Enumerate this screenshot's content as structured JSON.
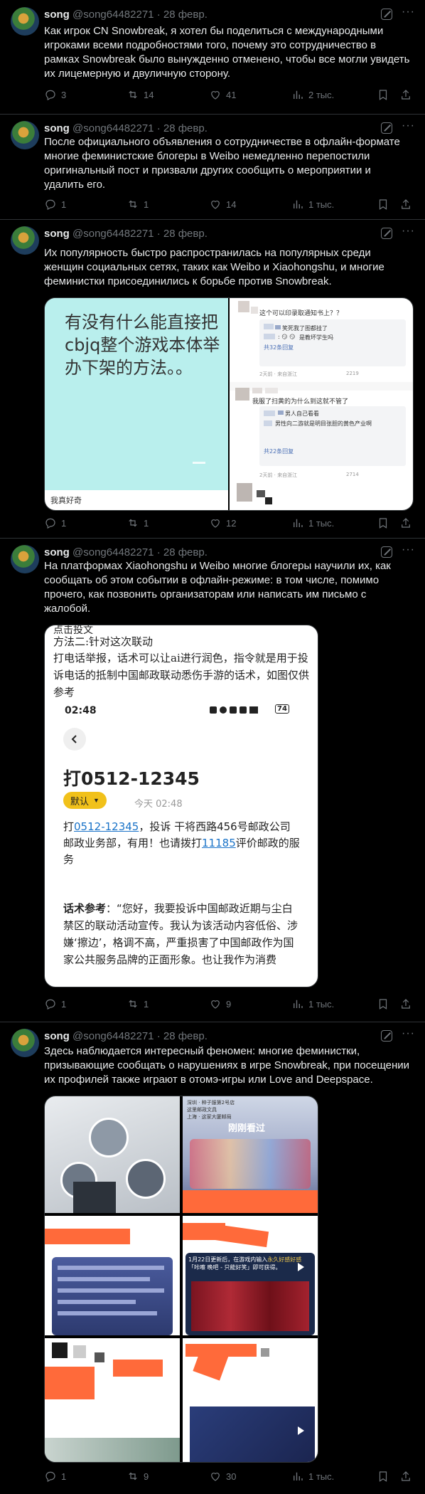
{
  "tweets": [
    {
      "name": "song",
      "handle": "@song64482271",
      "date": "· 28 февр.",
      "text": "Как игрок CN Snowbreak, я хотел бы поделиться с международными игроками всеми подробностями того, почему это сотрудничество в рамках Snowbreak было вынужденно отменено, чтобы все могли увидеть их лицемерную и двуличную сторону.",
      "replies": "3",
      "reposts": "14",
      "likes": "41",
      "views": "2 тыс."
    },
    {
      "name": "song",
      "handle": "@song64482271",
      "date": "· 28 февр.",
      "text": "После официального объявления о сотрудничестве в офлайн-формате многие феминистские блогеры в Weibo немедленно перепостили оригинальный пост и призвали других сообщить о мероприятии и удалить его.",
      "replies": "1",
      "reposts": "1",
      "likes": "14",
      "views": "1 тыс."
    },
    {
      "name": "song",
      "handle": "@song64482271",
      "date": "· 28 февр.",
      "text": "Их популярность быстро распространилась на популярных среди женщин социальных сетях, таких как Weibo и Xiaohongshu, и многие феминистки присоединились к борьбе против Snowbreak.",
      "replies": "1",
      "reposts": "1",
      "likes": "12",
      "views": "1 тыс."
    },
    {
      "name": "song",
      "handle": "@song64482271",
      "date": "· 28 февр.",
      "text": "На платформах Xiaohongshu и Weibo многие блогеры научили их, как сообщать об этом событии в офлайн-режиме: в том числе, помимо прочего, как позвонить организаторам или написать им письмо с жалобой.",
      "replies": "1",
      "reposts": "1",
      "likes": "9",
      "views": "1 тыс."
    },
    {
      "name": "song",
      "handle": "@song64482271",
      "date": "· 28 февр.",
      "text": "Здесь наблюдается интересный феномен: многие феминистки, призывающие сообщать о нарушениях в игре Snowbreak, при посещении их профилей также играют в отомэ-игры или Love and Deepspace.",
      "replies": "1",
      "reposts": "9",
      "likes": "30",
      "views": "1 тыс."
    }
  ],
  "media3": {
    "left_text": "有没有什么能直接把cbjq整个游戏本体举办下架的方法。。",
    "left_caption": "我真好奇",
    "c1": "这个可以印录取通知书上？？",
    "c1r1": "笑死我了图都挂了",
    "c1r2": "是教坏学生吗",
    "c1more": "共32条回复",
    "c1meta": "2天前 · 来自浙江",
    "c1count": "2219",
    "c2": "我服了扫黄的为什么到这就不管了",
    "c2r1": "男人自己看看",
    "c2r2": "男性向二游就是明目张胆的黄色产业啊",
    "c2more": "共22条回复",
    "c2meta": "2天前 · 来自浙江",
    "c2count": "2714"
  },
  "media4": {
    "top1": "点击投文",
    "top2": "方法二:针对这次联动",
    "top3": "打电话举报，话术可以让ai进行润色，指令就是用于投诉电话的抵制中国邮政联动悉伤手游的话术，如图仅供参考",
    "time": "02:48",
    "battery": "74",
    "phone_title": "打0512-12345",
    "tag": "默认",
    "tag_time": "今天 02:48",
    "body_prefix": "打",
    "body_link": "0512-12345",
    "body_mid": "，投诉 干将西路456号邮政公司邮政业务部，有用！也请拨打",
    "body_link2": "11185",
    "body_suffix": "评价邮政的服务",
    "script_label": "话术参考",
    "script_text": "：“您好，我要投诉中国邮政近期与尘白禁区的联动活动宣传。我认为该活动内容低俗、涉嫌‘擦边’，格调不高，严重损害了中国邮政作为国家公共服务品牌的正面形象。也让我作为消费"
  },
  "media5": {
    "g2_l1": "深圳 · 种子服第2号店",
    "g2_l2": "这里邮政文具",
    "g2_l3": "上海 · 这家大厦邮局",
    "g2_title": "刚刚看过",
    "g4_text1": "1月22日更新后，在游戏内输入",
    "g4_text2": "永久好感好感",
    "g4_text3": "「咔嚓 晚吧 - 只能好笑」即可获得。"
  },
  "colors": {
    "bg": "#000000",
    "text": "#e7e9ea",
    "muted": "#71767b",
    "border": "#2f3336",
    "link": "#1d9bf0",
    "orange": "#ff6a3a"
  }
}
